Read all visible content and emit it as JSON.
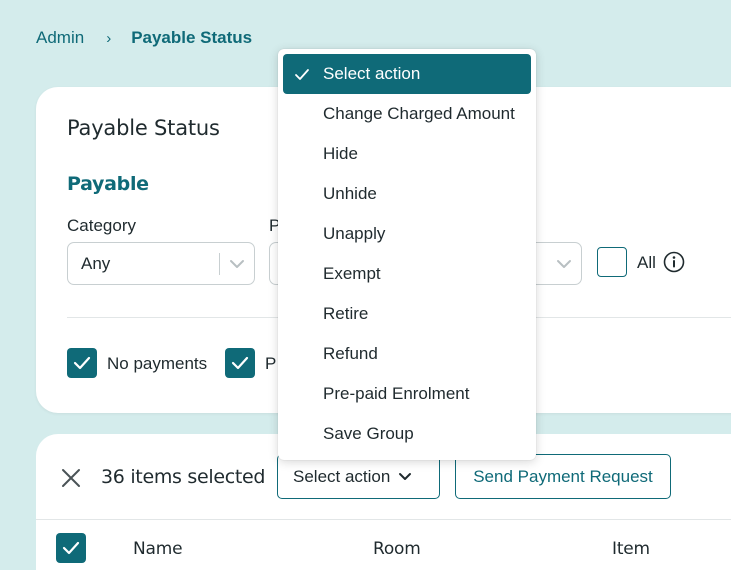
{
  "breadcrumb": {
    "parent": "Admin",
    "separator": "›",
    "current": "Payable Status"
  },
  "card": {
    "title": "Payable Status",
    "section_title": "Payable",
    "fields": [
      {
        "label": "Category",
        "value": "Any"
      },
      {
        "label": "P",
        "value": ""
      }
    ],
    "all_label": "All",
    "checkboxes": [
      {
        "label": "No payments",
        "checked": true
      },
      {
        "label": "P",
        "checked": true
      }
    ]
  },
  "list": {
    "selected_count": "36 items selected",
    "select_action_label": "Select action",
    "send_payment_request_label": "Send Payment Request",
    "columns": [
      "Name",
      "Room",
      "Item"
    ]
  },
  "dropdown": {
    "items": [
      {
        "label": "Select action",
        "selected": true
      },
      {
        "label": "Change Charged Amount"
      },
      {
        "label": "Hide"
      },
      {
        "label": "Unhide"
      },
      {
        "label": "Unapply"
      },
      {
        "label": "Exempt"
      },
      {
        "label": "Retire"
      },
      {
        "label": "Refund"
      },
      {
        "label": "Pre-paid Enrolment"
      },
      {
        "label": "Save Group"
      }
    ]
  },
  "colors": {
    "accent": "#0f6a78",
    "background": "#d4ecec",
    "card": "#ffffff"
  },
  "icons": {
    "check": "check-icon",
    "chevron": "chevron-down-icon",
    "info": "info-icon",
    "close": "close-icon"
  }
}
